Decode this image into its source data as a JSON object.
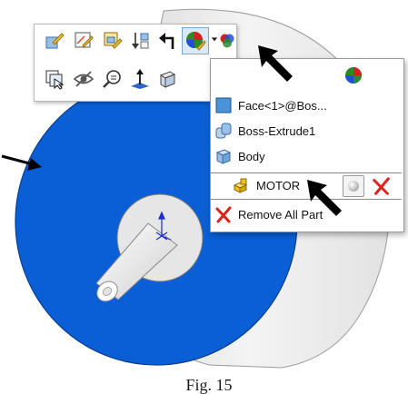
{
  "caption": "Fig. 15",
  "menu": {
    "items": [
      {
        "label": "Face<1>@Bos..."
      },
      {
        "label": "Boss-Extrude1"
      },
      {
        "label": "Body"
      },
      {
        "label": "MOTOR"
      },
      {
        "label": "Remove All Part"
      }
    ]
  },
  "colors": {
    "face_blue": "#0a5fd6",
    "cylinder_grey": "#e8e8e8",
    "remove_red": "#e0201a",
    "part_yellow": "#f2c21b"
  },
  "icons": [
    "edit-part-icon",
    "edit-sketch-icon",
    "edit-feature-icon",
    "rollback-icon",
    "back-icon",
    "appearance-icon",
    "appearance-dropdown-icon",
    "display-pane-icon",
    "select-other-icon",
    "hide-icon",
    "zoom-to-selection-icon",
    "normal-to-icon",
    "view-icon"
  ]
}
